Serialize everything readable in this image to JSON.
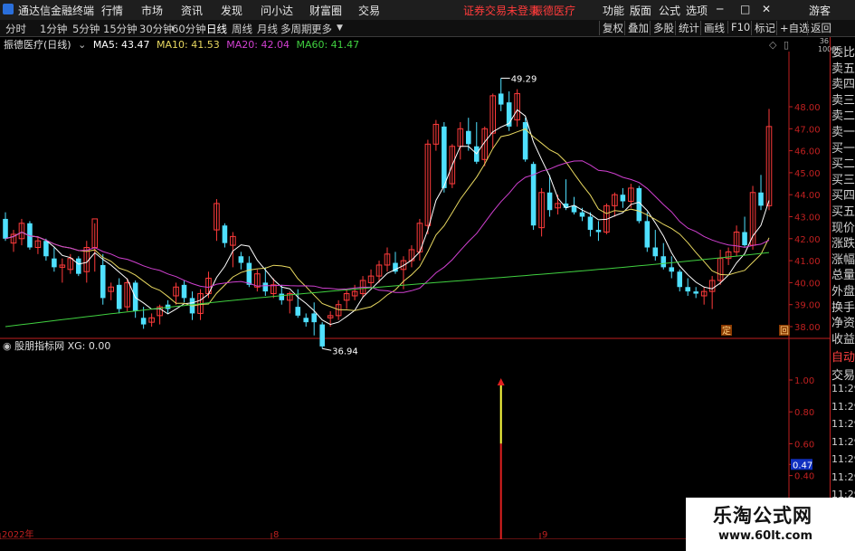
{
  "menubar": {
    "app_title": "通达信金融终端",
    "menus": [
      "行情",
      "市场",
      "资讯",
      "发现",
      "问小达",
      "财富圈",
      "交易"
    ],
    "trade_status": "证券交易未登录",
    "stock_name": "振德医疗",
    "right_menus": [
      "功能",
      "版面",
      "公式",
      "选项"
    ],
    "guest": "游客"
  },
  "periods": [
    "分时",
    "1分钟",
    "5分钟",
    "15分钟",
    "30分钟",
    "60分钟",
    "日线",
    "周线",
    "月线",
    "多周期",
    "更多"
  ],
  "active_period": "日线",
  "toolbar": [
    "复权",
    "叠加",
    "多股",
    "统计",
    "画线",
    "F10",
    "标记",
    "+自选",
    "返回"
  ],
  "info": {
    "title": "振德医疗(日线)",
    "ma5": "MA5: 43.47",
    "ma10": "MA10: 41.53",
    "ma20": "MA20: 42.04",
    "ma60": "MA60: 41.47"
  },
  "indicator": {
    "name": "股朋指标网",
    "value": "XG: 0.00"
  },
  "annotations": {
    "high": "49.29",
    "low": "36.94"
  },
  "right_panel": [
    "委比",
    "卖五",
    "卖四",
    "卖三",
    "卖二",
    "卖一",
    "买一",
    "买二",
    "买三",
    "买四",
    "买五",
    "现价",
    "涨跌",
    "涨幅",
    "总量",
    "外盘",
    "换手",
    "净资",
    "收益"
  ],
  "right_panel_lower": [
    "自动",
    "交易",
    "11:29",
    "11:29",
    "11:29",
    "11:29",
    "11:29",
    "11:29",
    "11:29",
    "11:29"
  ],
  "right_panel_top": [
    "36",
    "1000"
  ],
  "markers": {
    "ding": "定",
    "box": "回"
  },
  "dates": [
    "2022年",
    "8",
    "9"
  ],
  "watermark": {
    "title": "乐淘公式网",
    "url": "www.60lt.com"
  },
  "colors": {
    "up": "#ff3b3b",
    "down": "#4fe0ff",
    "ma5": "#ffffff",
    "ma10": "#e8d860",
    "ma20": "#d040d0",
    "ma60": "#40d040",
    "axis": "#c02020"
  },
  "chart_data": {
    "type": "candlestick",
    "price_axis": [
      48.0,
      47.0,
      46.0,
      45.0,
      44.0,
      43.0,
      42.0,
      41.0,
      40.0,
      39.0,
      38.0
    ],
    "indicator_axis": [
      "1.00",
      "0.80",
      "0.60",
      "0.47",
      "0.40",
      "0.20"
    ],
    "indicator_signal": {
      "index": 61,
      "value": 1.0,
      "xg": 0.0
    },
    "candles": [
      [
        42.9,
        43.2,
        41.9,
        42.0
      ],
      [
        41.8,
        42.4,
        41.4,
        42.2
      ],
      [
        42.0,
        42.9,
        41.7,
        42.7
      ],
      [
        42.7,
        42.8,
        41.5,
        41.6
      ],
      [
        41.6,
        42.1,
        41.3,
        41.9
      ],
      [
        41.9,
        42.0,
        41.0,
        41.2
      ],
      [
        41.1,
        41.6,
        40.5,
        40.7
      ],
      [
        40.7,
        41.1,
        40.0,
        40.8
      ],
      [
        40.6,
        41.3,
        40.4,
        41.1
      ],
      [
        41.1,
        41.2,
        40.3,
        40.4
      ],
      [
        40.5,
        41.9,
        40.0,
        41.6
      ],
      [
        41.6,
        42.7,
        40.5,
        42.9
      ],
      [
        40.8,
        41.3,
        39.0,
        39.3
      ],
      [
        39.6,
        40.0,
        39.2,
        39.8
      ],
      [
        39.9,
        40.2,
        38.6,
        38.8
      ],
      [
        38.9,
        40.2,
        38.7,
        40.0
      ],
      [
        40.0,
        40.1,
        38.4,
        38.7
      ],
      [
        38.4,
        38.9,
        37.9,
        38.1
      ],
      [
        38.2,
        38.6,
        38.0,
        38.4
      ],
      [
        38.5,
        39.0,
        38.1,
        38.9
      ],
      [
        39.0,
        39.2,
        38.6,
        38.8
      ],
      [
        39.4,
        40.0,
        39.0,
        39.8
      ],
      [
        39.9,
        40.1,
        39.1,
        39.3
      ],
      [
        39.3,
        39.6,
        38.3,
        38.6
      ],
      [
        38.6,
        39.7,
        38.3,
        39.5
      ],
      [
        39.5,
        40.5,
        39.3,
        40.2
      ],
      [
        42.4,
        43.8,
        41.9,
        43.6
      ],
      [
        42.6,
        42.7,
        41.6,
        41.8
      ],
      [
        41.7,
        42.3,
        40.7,
        42.1
      ],
      [
        41.2,
        41.4,
        40.6,
        40.9
      ],
      [
        40.9,
        41.2,
        39.8,
        39.9
      ],
      [
        39.8,
        40.6,
        39.6,
        40.4
      ],
      [
        40.0,
        40.7,
        39.4,
        39.6
      ],
      [
        39.5,
        40.2,
        39.3,
        39.9
      ],
      [
        39.5,
        39.9,
        39.0,
        39.2
      ],
      [
        39.2,
        39.6,
        38.6,
        39.5
      ],
      [
        38.9,
        39.7,
        38.4,
        38.5
      ],
      [
        38.4,
        38.6,
        38.0,
        38.2
      ],
      [
        38.6,
        39.1,
        37.6,
        38.2
      ],
      [
        38.1,
        38.2,
        37.0,
        37.1
      ],
      [
        38.4,
        38.7,
        38.0,
        38.5
      ],
      [
        38.5,
        39.2,
        38.3,
        39.0
      ],
      [
        39.2,
        39.7,
        38.8,
        39.5
      ],
      [
        39.4,
        39.9,
        39.2,
        39.6
      ],
      [
        39.5,
        40.3,
        39.3,
        40.1
      ],
      [
        40.0,
        40.6,
        39.8,
        40.3
      ],
      [
        40.3,
        41.0,
        40.0,
        40.8
      ],
      [
        40.8,
        41.6,
        40.5,
        41.3
      ],
      [
        40.9,
        41.4,
        40.4,
        40.5
      ],
      [
        40.6,
        41.2,
        39.7,
        41.0
      ],
      [
        41.0,
        41.7,
        40.7,
        41.5
      ],
      [
        41.4,
        42.9,
        41.0,
        42.7
      ],
      [
        42.6,
        46.5,
        42.2,
        46.3
      ],
      [
        46.3,
        47.4,
        46.0,
        47.2
      ],
      [
        47.1,
        47.3,
        44.1,
        44.3
      ],
      [
        44.5,
        46.3,
        44.3,
        46.2
      ],
      [
        46.2,
        47.3,
        45.6,
        47.0
      ],
      [
        46.9,
        47.5,
        46.0,
        46.3
      ],
      [
        46.2,
        47.3,
        45.4,
        45.5
      ],
      [
        45.6,
        47.1,
        45.3,
        47.0
      ],
      [
        46.8,
        48.6,
        46.1,
        48.5
      ],
      [
        48.6,
        49.3,
        47.8,
        48.1
      ],
      [
        48.2,
        48.7,
        46.9,
        47.1
      ],
      [
        47.4,
        48.8,
        47.1,
        48.6
      ],
      [
        47.3,
        47.5,
        45.5,
        45.6
      ],
      [
        45.4,
        45.5,
        42.4,
        42.6
      ],
      [
        42.5,
        44.3,
        42.1,
        44.1
      ],
      [
        44.1,
        44.9,
        43.0,
        43.3
      ],
      [
        43.4,
        44.0,
        43.1,
        43.6
      ],
      [
        43.6,
        44.7,
        43.3,
        43.4
      ],
      [
        43.5,
        43.9,
        43.1,
        43.2
      ],
      [
        43.2,
        43.4,
        42.8,
        43.0
      ],
      [
        43.0,
        43.2,
        42.1,
        42.4
      ],
      [
        42.4,
        42.8,
        41.9,
        42.3
      ],
      [
        42.3,
        43.6,
        42.2,
        43.5
      ],
      [
        43.5,
        44.1,
        43.0,
        44.0
      ],
      [
        44.0,
        44.3,
        43.4,
        43.7
      ],
      [
        43.7,
        44.5,
        43.4,
        44.3
      ],
      [
        44.3,
        44.4,
        42.7,
        42.8
      ],
      [
        42.8,
        43.2,
        41.4,
        41.6
      ],
      [
        41.6,
        42.4,
        41.0,
        41.2
      ],
      [
        41.2,
        41.8,
        40.6,
        40.7
      ],
      [
        40.7,
        41.2,
        40.2,
        40.5
      ],
      [
        40.5,
        40.6,
        39.6,
        39.8
      ],
      [
        39.8,
        40.2,
        39.4,
        39.6
      ],
      [
        39.6,
        39.8,
        39.3,
        39.5
      ],
      [
        39.4,
        39.8,
        39.0,
        39.6
      ],
      [
        39.6,
        40.3,
        38.8,
        40.1
      ],
      [
        40.1,
        41.5,
        39.9,
        41.1
      ],
      [
        41.1,
        41.6,
        40.8,
        41.4
      ],
      [
        41.4,
        42.6,
        41.2,
        42.3
      ],
      [
        42.3,
        43.0,
        41.6,
        41.7
      ],
      [
        41.7,
        44.4,
        41.5,
        44.1
      ],
      [
        44.1,
        44.9,
        43.3,
        43.5
      ],
      [
        43.5,
        47.9,
        43.3,
        47.1
      ]
    ]
  }
}
